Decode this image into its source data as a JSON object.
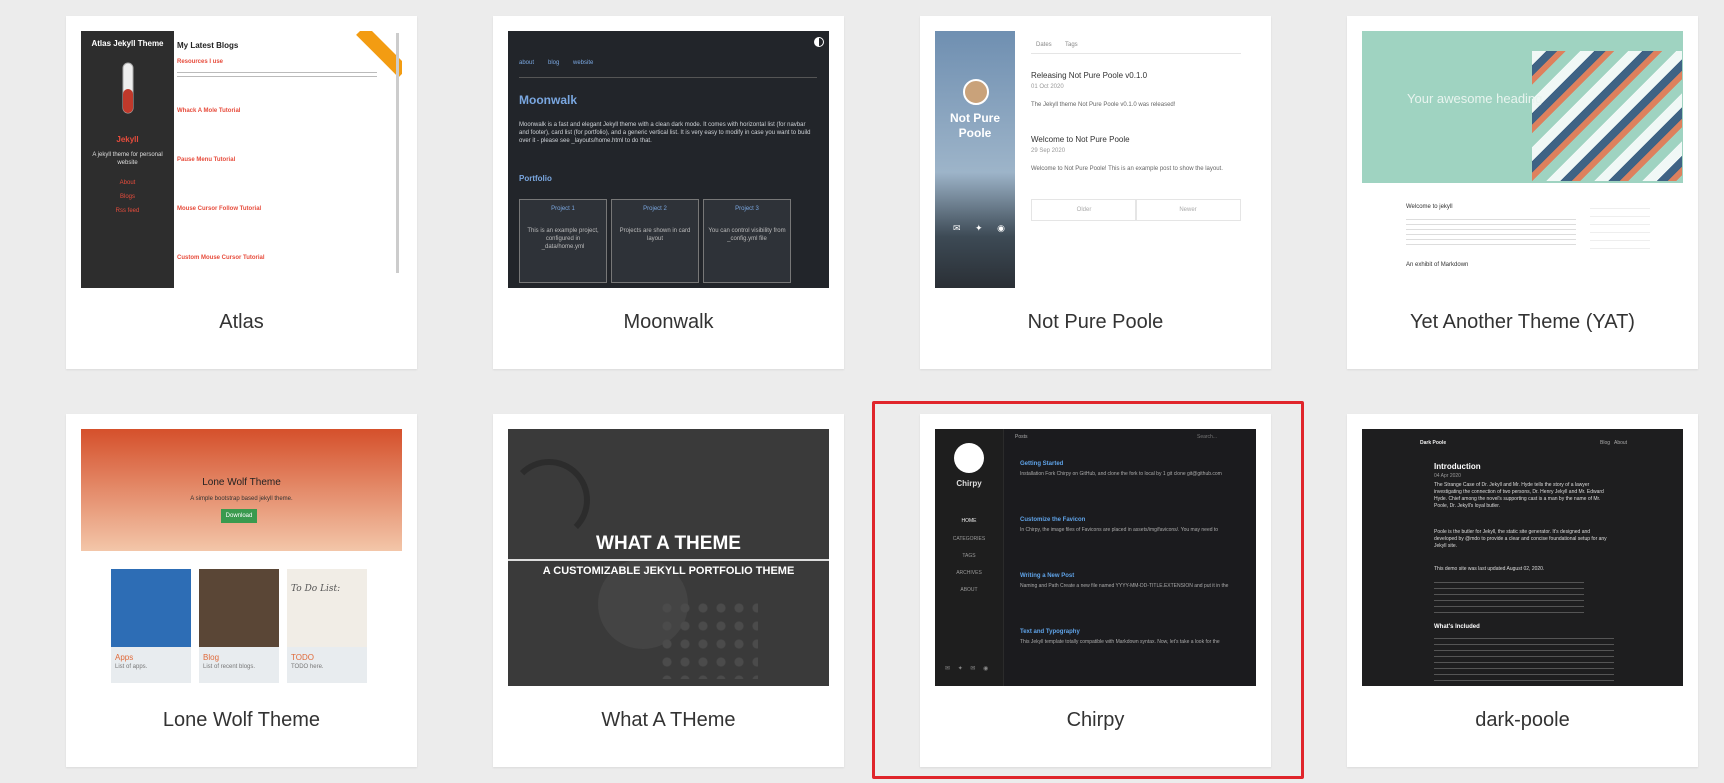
{
  "themes": [
    {
      "title": "Atlas"
    },
    {
      "title": "Moonwalk"
    },
    {
      "title": "Not Pure Poole"
    },
    {
      "title": "Yet Another Theme (YAT)"
    },
    {
      "title": "Lone Wolf Theme"
    },
    {
      "title": "What A THeme"
    },
    {
      "title": "Chirpy"
    },
    {
      "title": "dark-poole"
    }
  ],
  "atlas": {
    "sidebar_title": "Atlas Jekyll Theme",
    "brand": "Jekyll",
    "tagline": "A jekyll theme for personal website",
    "nav": [
      "About",
      "Blogs",
      "Rss feed"
    ],
    "heading": "My Latest Blogs",
    "posts": [
      "Resources I use",
      "Whack A Mole Tutorial",
      "Pause Menu Tutorial",
      "Mouse Cursor Follow Tutorial",
      "Custom Mouse Cursor Tutorial"
    ]
  },
  "moonwalk": {
    "nav": [
      "about",
      "blog",
      "website"
    ],
    "heading": "Moonwalk",
    "intro": "Moonwalk is a fast and elegant Jekyll theme with a clean dark mode. It comes with horizontal list (for navbar and footer), card list (for portfolio), and a generic vertical list. It is very easy to modify in case you want to build over it - please see _layouts/home.html to do that.",
    "portfolio": "Portfolio",
    "projects": [
      {
        "name": "Project 1",
        "desc": "This is an example project, configured in _data/home.yml"
      },
      {
        "name": "Project 2",
        "desc": "Projects are shown in card layout"
      },
      {
        "name": "Project 3",
        "desc": "You can control visibility from _config.yml file"
      }
    ]
  },
  "notpure": {
    "site": "Not Pure Poole",
    "tabs": [
      "Dates",
      "Tags"
    ],
    "posts": [
      {
        "title": "Releasing Not Pure Poole v0.1.0",
        "date": "01 Oct 2020",
        "excerpt": "The Jekyll theme Not Pure Poole v0.1.0 was released!"
      },
      {
        "title": "Welcome to Not Pure Poole",
        "date": "29 Sep 2020",
        "excerpt": "Welcome to Not Pure Poole! This is an example post to show the layout."
      }
    ],
    "pager": [
      "Older",
      "Newer"
    ]
  },
  "yat": {
    "hero": "Your awesome heading",
    "post1": "Welcome to jekyll",
    "post2": "An exhibit of Markdown"
  },
  "lonewolf": {
    "title": "Lone Wolf Theme",
    "subtitle": "A simple bootstrap based jekyll theme.",
    "download": "Download",
    "cards": [
      {
        "name": "Apps",
        "desc": "List of apps."
      },
      {
        "name": "Blog",
        "desc": "List of recent blogs."
      },
      {
        "name": "TODO",
        "desc": "TODO here."
      }
    ],
    "todo_note": "To Do List:"
  },
  "whatatheme": {
    "headline": "WHAT A THEME",
    "sub": "A CUSTOMIZABLE JEKYLL PORTFOLIO THEME"
  },
  "chirpy": {
    "name": "Chirpy",
    "topbar": "Posts",
    "search": "Search...",
    "nav": [
      "HOME",
      "CATEGORIES",
      "TAGS",
      "ARCHIVES",
      "ABOUT"
    ],
    "posts": [
      {
        "title": "Getting Started",
        "excerpt": "Installation Fork Chirpy on GitHub, and clone the fork to local by 1 git clone git@github.com"
      },
      {
        "title": "Customize the Favicon",
        "excerpt": "In Chirpy, the image files of Favicons are placed in assets/img/favicons/. You may need to"
      },
      {
        "title": "Writing a New Post",
        "excerpt": "Naming and Path Create a new file named YYYY-MM-DD-TITLE.EXTENSION and put it in the"
      },
      {
        "title": "Text and Typography",
        "excerpt": "This Jekyll template totally compatible with Markdown syntax. Now, let's take a look for the"
      }
    ]
  },
  "darkpoole": {
    "brand": "Dark Poole",
    "nav": [
      "Blog",
      "About"
    ],
    "heading": "Introduction",
    "date": "04 Apr 2020",
    "para1": "The Strange Case of Dr. Jekyll and Mr. Hyde tells the story of a lawyer investigating the connection of two persons, Dr. Henry Jekyll and Mr. Edward Hyde. Chief among the novel's supporting cast is a man by the name of Mr. Poole, Dr. Jekyll's loyal butler.",
    "para2": "Poole is the butler for Jekyll, the static site generator. It's designed and developed by @mdo to provide a clear and concise foundational setup for any Jekyll site.",
    "updated": "This demo site was last updated August 02, 2020.",
    "included": "What's Included"
  }
}
